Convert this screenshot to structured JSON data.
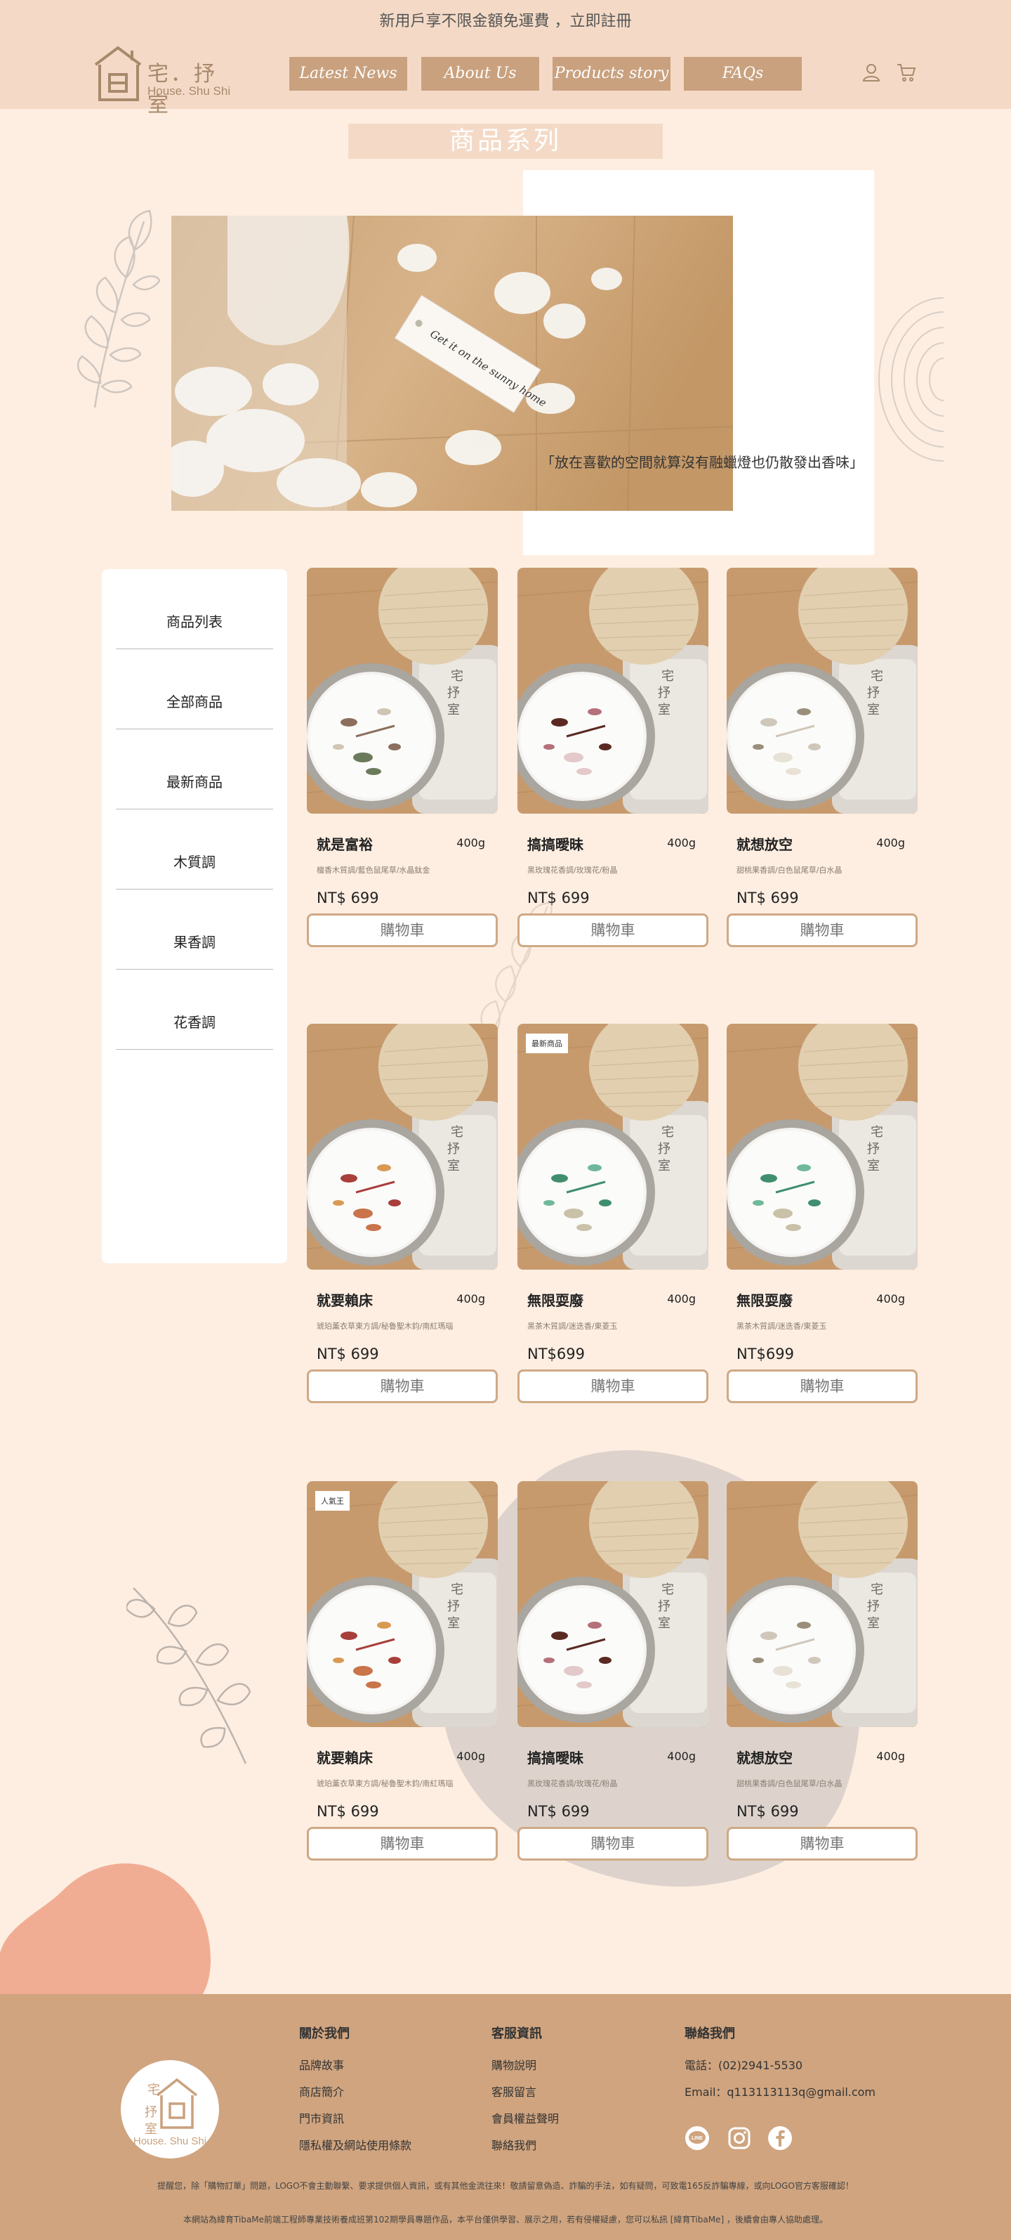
{
  "header": {
    "promo": "新用戶享不限金額免運費 ，立即註冊",
    "logo_cn": "宅．抒室",
    "logo_en": "House. Shu Shi",
    "nav": [
      "Latest News",
      "About Us",
      "Products story",
      "FAQs"
    ]
  },
  "hero": {
    "section_title": "商品系列",
    "tag_text": "Get it on the sunny home",
    "quote": "「放在喜歡的空間就算沒有融蠟燈也仍散發出香味」"
  },
  "sidebar": {
    "items": [
      "商品列表",
      "全部商品",
      "最新商品",
      "木質調",
      "果香調",
      "花香調"
    ]
  },
  "products": [
    {
      "name": "就是富裕",
      "weight": "400g",
      "notes": "檀香木質調/藍色鼠尾草/水晶鈦金",
      "price": "NT$ 699",
      "buy": "購物車",
      "badge": ""
    },
    {
      "name": "搞搞曖昧",
      "weight": "400g",
      "notes": "黑玫瑰花香調/玫瑰花/粉晶",
      "price": "NT$ 699",
      "buy": "購物車",
      "badge": ""
    },
    {
      "name": "就想放空",
      "weight": "400g",
      "notes": "甜桃果香調/白色鼠尾草/白水晶",
      "price": "NT$ 699",
      "buy": "購物車",
      "badge": ""
    },
    {
      "name": "就要賴床",
      "weight": "400g",
      "notes": "琥珀薰衣草東方調/秘魯聖木鈞/南紅瑪瑙",
      "price": "NT$ 699",
      "buy": "購物車",
      "badge": ""
    },
    {
      "name": "無限耍廢",
      "weight": "400g",
      "notes": "黑茶木質調/迷迭香/東菱玉",
      "price": "NT$699",
      "buy": "購物車",
      "badge": "最新商品"
    },
    {
      "name": "無限耍廢",
      "weight": "400g",
      "notes": "黑茶木質調/迷迭香/東菱玉",
      "price": "NT$699",
      "buy": "購物車",
      "badge": ""
    },
    {
      "name": "就要賴床",
      "weight": "400g",
      "notes": "琥珀薰衣草東方調/秘魯聖木鈞/南紅瑪瑙",
      "price": "NT$ 699",
      "buy": "購物車",
      "badge": "人氣王"
    },
    {
      "name": "搞搞曖昧",
      "weight": "400g",
      "notes": "黑玫瑰花香調/玫瑰花/粉晶",
      "price": "NT$ 699",
      "buy": "購物車",
      "badge": ""
    },
    {
      "name": "就想放空",
      "weight": "400g",
      "notes": "甜桃果香調/白色鼠尾草/白水晶",
      "price": "NT$ 699",
      "buy": "購物車",
      "badge": ""
    }
  ],
  "footer": {
    "about_title": "關於我們",
    "about_links": [
      "品牌故事",
      "商店簡介",
      "門市資訊",
      "隱私權及網站使用條款"
    ],
    "service_title": "客服資訊",
    "service_links": [
      "購物說明",
      "客服留言",
      "會員權益聲明",
      "聯絡我們"
    ],
    "contact_title": "聯絡我們",
    "phone": "電話：(02)2941-5530",
    "email": "Email：q113113113q@gmail.com",
    "social": [
      "line-icon",
      "instagram-icon",
      "facebook-icon"
    ],
    "line_label": "LINE",
    "notice": "提醒您，除「購物訂單」問題，LOGO不會主動聯繫、要求提供個人資訊，或有其他金流往來！敬請留意偽造、詐騙的手法，如有疑問，可致電165反詐騙專線，或向LOGO官方客服確認！",
    "disclaimer": "本網站為緯育TibaMe前端工程師專業技術養成班第102期學員專題作品，本平台僅供學習、展示之用，若有侵權疑慮，您可以私訊 [緯育TibaMe] ，後續會由專人協助處理。"
  },
  "colors": {
    "page_bg": "#fdeee1",
    "header_bg": "#f4dac6",
    "accent": "#c9a17e",
    "footer_bg": "#cfa47f",
    "blob_salmon": "#f1ad93",
    "blob_gray": "#ddd3cc"
  }
}
